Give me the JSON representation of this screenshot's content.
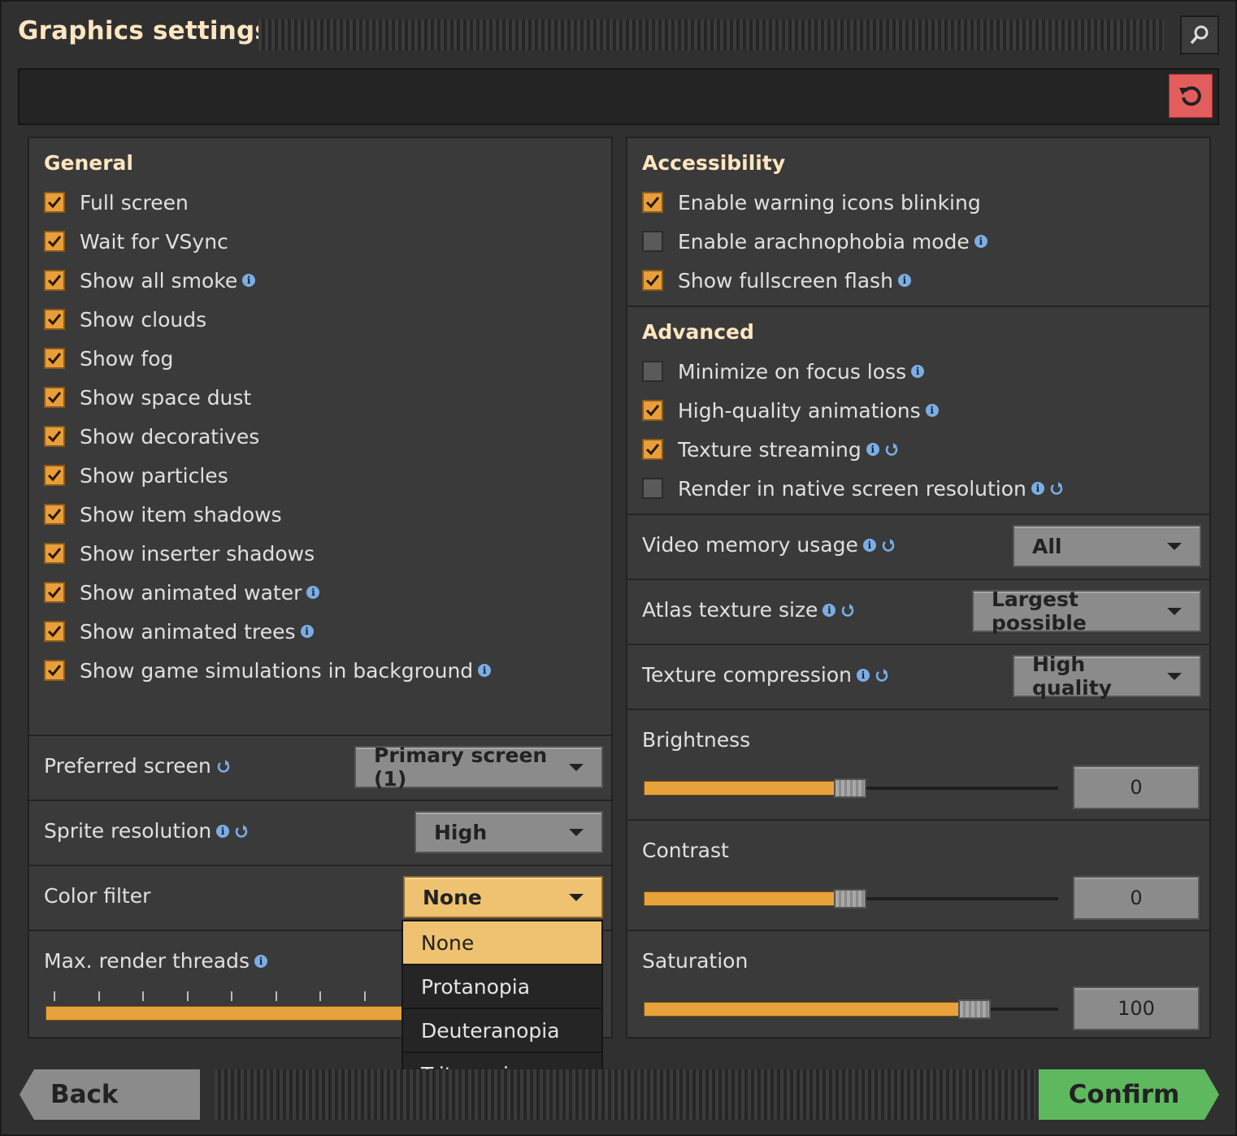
{
  "window": {
    "title": "Graphics settings"
  },
  "general": {
    "heading": "General",
    "options": [
      {
        "label": "Full screen",
        "checked": true,
        "info": false
      },
      {
        "label": "Wait for VSync",
        "checked": true,
        "info": false
      },
      {
        "label": "Show all smoke",
        "checked": true,
        "info": true
      },
      {
        "label": "Show clouds",
        "checked": true,
        "info": false
      },
      {
        "label": "Show fog",
        "checked": true,
        "info": false
      },
      {
        "label": "Show space dust",
        "checked": true,
        "info": false
      },
      {
        "label": "Show decoratives",
        "checked": true,
        "info": false
      },
      {
        "label": "Show particles",
        "checked": true,
        "info": false
      },
      {
        "label": "Show item shadows",
        "checked": true,
        "info": false
      },
      {
        "label": "Show inserter shadows",
        "checked": true,
        "info": false
      },
      {
        "label": "Show animated water",
        "checked": true,
        "info": true
      },
      {
        "label": "Show animated trees",
        "checked": true,
        "info": true
      },
      {
        "label": "Show game simulations in background",
        "checked": true,
        "info": true
      }
    ]
  },
  "left_rows": {
    "preferred_screen": {
      "label": "Preferred screen",
      "value": "Primary screen (1)"
    },
    "sprite_resolution": {
      "label": "Sprite resolution",
      "value": "High"
    },
    "color_filter": {
      "label": "Color filter",
      "value": "None",
      "options": [
        "None",
        "Protanopia",
        "Deuteranopia",
        "Tritanopia"
      ]
    },
    "max_render_threads": {
      "label": "Max. render threads"
    }
  },
  "accessibility": {
    "heading": "Accessibility",
    "options": [
      {
        "label": "Enable warning icons blinking",
        "checked": true
      },
      {
        "label": "Enable arachnophobia mode",
        "checked": false
      },
      {
        "label": "Show fullscreen flash",
        "checked": true
      }
    ]
  },
  "advanced": {
    "heading": "Advanced",
    "options": [
      {
        "label": "Minimize on focus loss",
        "checked": false
      },
      {
        "label": "High-quality animations",
        "checked": true
      },
      {
        "label": "Texture streaming",
        "checked": true
      },
      {
        "label": "Render in native screen resolution",
        "checked": false
      }
    ]
  },
  "right_rows": {
    "video_memory": {
      "label": "Video memory usage",
      "value": "All"
    },
    "atlas_size": {
      "label": "Atlas texture size",
      "value": "Largest possible"
    },
    "texture_compression": {
      "label": "Texture compression",
      "value": "High quality"
    }
  },
  "sliders": {
    "brightness": {
      "label": "Brightness",
      "value": "0",
      "fraction": 0.5
    },
    "contrast": {
      "label": "Contrast",
      "value": "0",
      "fraction": 0.5
    },
    "saturation": {
      "label": "Saturation",
      "value": "100",
      "fraction": 0.82
    }
  },
  "footer": {
    "back": "Back",
    "confirm": "Confirm"
  },
  "colors": {
    "accent": "#e8a23c",
    "highlight": "#eec270",
    "confirm": "#5eb95e",
    "reset": "#e35d5d",
    "heading": "#ffe6c0"
  }
}
